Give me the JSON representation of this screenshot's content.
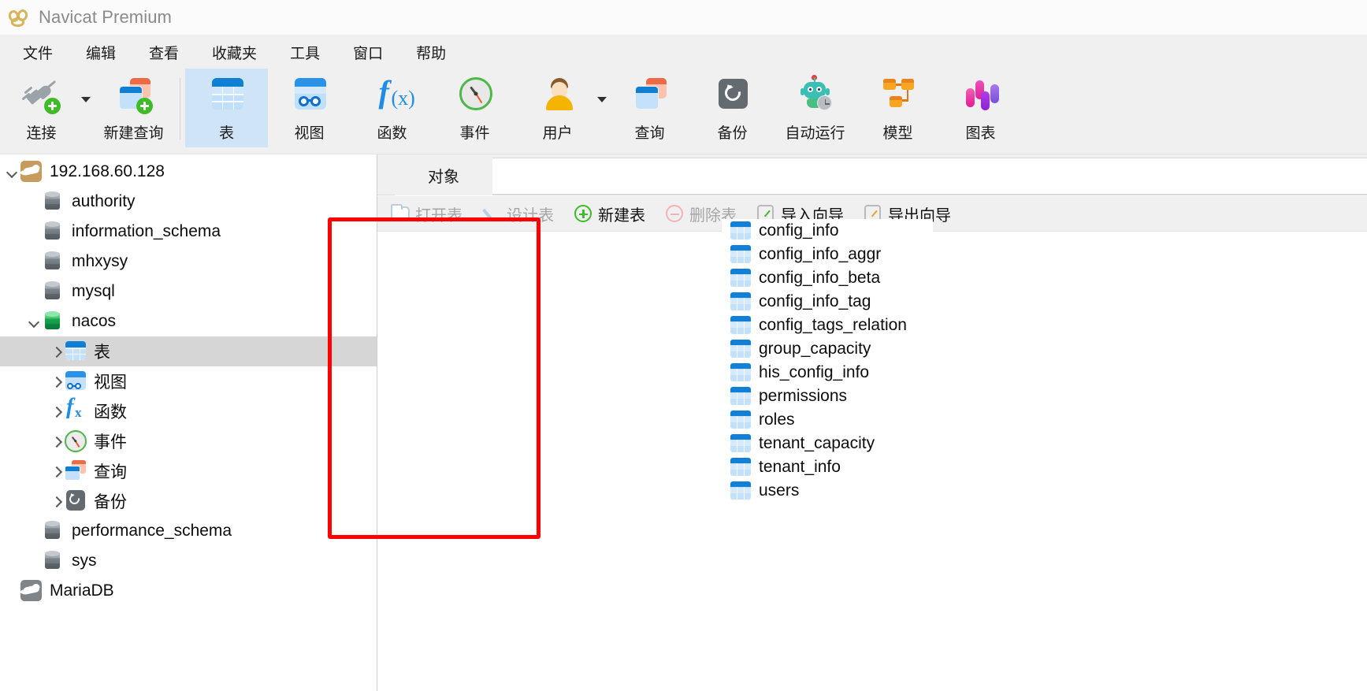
{
  "window": {
    "title": "Navicat Premium",
    "logo_icon": "navicat-paw-logo"
  },
  "menubar": {
    "items": [
      {
        "label": "文件",
        "name": "menu-file"
      },
      {
        "label": "编辑",
        "name": "menu-edit"
      },
      {
        "label": "查看",
        "name": "menu-view"
      },
      {
        "label": "收藏夹",
        "name": "menu-favorites"
      },
      {
        "label": "工具",
        "name": "menu-tools"
      },
      {
        "label": "窗口",
        "name": "menu-window"
      },
      {
        "label": "帮助",
        "name": "menu-help"
      }
    ]
  },
  "toolbar": {
    "items": [
      {
        "label": "连接",
        "icon": "connection-plug-icon",
        "active": false,
        "caret": true
      },
      {
        "label": "新建查询",
        "icon": "new-query-icon",
        "active": false,
        "caret": false
      },
      {
        "label": "表",
        "icon": "table-icon",
        "active": true,
        "caret": false
      },
      {
        "label": "视图",
        "icon": "view-glasses-icon",
        "active": false,
        "caret": false
      },
      {
        "label": "函数",
        "icon": "function-fx-icon",
        "active": false,
        "caret": false
      },
      {
        "label": "事件",
        "icon": "event-clock-icon",
        "active": false,
        "caret": false
      },
      {
        "label": "用户",
        "icon": "user-avatar-icon",
        "active": false,
        "caret": true
      },
      {
        "label": "查询",
        "icon": "query-icon",
        "active": false,
        "caret": false
      },
      {
        "label": "备份",
        "icon": "backup-restore-icon",
        "active": false,
        "caret": false
      },
      {
        "label": "自动运行",
        "icon": "automation-robot-icon",
        "active": false,
        "caret": false
      },
      {
        "label": "模型",
        "icon": "model-diagram-icon",
        "active": false,
        "caret": false
      },
      {
        "label": "图表",
        "icon": "chart-bars-icon",
        "active": false,
        "caret": false
      }
    ]
  },
  "sidebar": {
    "nodes": [
      {
        "label": "192.168.60.128",
        "icon": "mariadb-seal-icon",
        "indent": 0,
        "twisty": "down",
        "selected": false
      },
      {
        "label": "authority",
        "icon": "database-icon",
        "indent": 1,
        "twisty": "none",
        "selected": false
      },
      {
        "label": "information_schema",
        "icon": "database-icon",
        "indent": 1,
        "twisty": "none",
        "selected": false
      },
      {
        "label": "mhxysy",
        "icon": "database-icon",
        "indent": 1,
        "twisty": "none",
        "selected": false
      },
      {
        "label": "mysql",
        "icon": "database-icon",
        "indent": 1,
        "twisty": "none",
        "selected": false
      },
      {
        "label": "nacos",
        "icon": "database-open-icon",
        "indent": 1,
        "twisty": "down",
        "selected": false
      },
      {
        "label": "表",
        "icon": "table-icon",
        "indent": 2,
        "twisty": "right",
        "selected": true
      },
      {
        "label": "视图",
        "icon": "view-glasses-icon",
        "indent": 2,
        "twisty": "right",
        "selected": false
      },
      {
        "label": "函数",
        "icon": "function-fx-icon",
        "indent": 2,
        "twisty": "right",
        "selected": false
      },
      {
        "label": "事件",
        "icon": "event-clock-icon",
        "indent": 2,
        "twisty": "right",
        "selected": false
      },
      {
        "label": "查询",
        "icon": "query-icon",
        "indent": 2,
        "twisty": "right",
        "selected": false
      },
      {
        "label": "备份",
        "icon": "backup-restore-icon",
        "indent": 2,
        "twisty": "right",
        "selected": false
      },
      {
        "label": "performance_schema",
        "icon": "database-icon",
        "indent": 1,
        "twisty": "none",
        "selected": false
      },
      {
        "label": "sys",
        "icon": "database-icon",
        "indent": 1,
        "twisty": "none",
        "selected": false
      },
      {
        "label": "MariaDB",
        "icon": "mariadb-seal-gray-icon",
        "indent": 0,
        "twisty": "none",
        "selected": false
      }
    ]
  },
  "main": {
    "tab": {
      "label": "对象",
      "name": "tab-object"
    },
    "actions": [
      {
        "label": "打开表",
        "icon": "open-table-folder-icon",
        "enabled": false
      },
      {
        "label": "设计表",
        "icon": "design-table-pencil-icon",
        "enabled": false
      },
      {
        "label": "新建表",
        "icon": "new-table-plus-icon",
        "enabled": true
      },
      {
        "label": "删除表",
        "icon": "delete-table-minus-icon",
        "enabled": false
      },
      {
        "label": "导入向导",
        "icon": "import-wizard-icon",
        "enabled": true
      },
      {
        "label": "导出向导",
        "icon": "export-wizard-icon",
        "enabled": true
      }
    ],
    "tables": [
      "config_info",
      "config_info_aggr",
      "config_info_beta",
      "config_info_tag",
      "config_tags_relation",
      "group_capacity",
      "his_config_info",
      "permissions",
      "roles",
      "tenant_capacity",
      "tenant_info",
      "users"
    ]
  },
  "annotation": {
    "highlight_color": "#ff0000",
    "name": "red-highlight-box-around-table-list"
  }
}
